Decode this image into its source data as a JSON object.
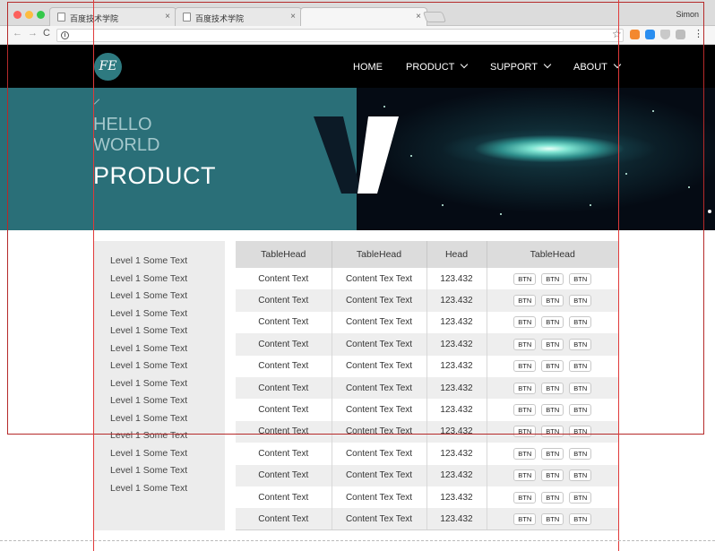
{
  "browser": {
    "tabs": [
      {
        "title": "百度技术学院",
        "close": "×"
      },
      {
        "title": "百度技术学院",
        "close": "×"
      },
      {
        "title": "",
        "close": "×"
      }
    ],
    "profile": "Simon",
    "nav": {
      "back": "←",
      "forward": "→",
      "reload": "C"
    },
    "url": ""
  },
  "header": {
    "logo": "FE",
    "nav": [
      {
        "label": "HOME",
        "dropdown": false
      },
      {
        "label": "PRODUCT",
        "dropdown": true
      },
      {
        "label": "SUPPORT",
        "dropdown": true
      },
      {
        "label": "ABOUT",
        "dropdown": true
      }
    ]
  },
  "hero": {
    "hello": "HELLO",
    "world": "WORLD",
    "title": "PRODUCT",
    "colors": {
      "teal": "#2a6f78"
    }
  },
  "sidebar": {
    "items": [
      "Level 1 Some Text",
      "Level 1 Some Text",
      "Level 1 Some Text",
      "Level 1 Some Text",
      "Level 1 Some Text",
      "Level 1 Some Text",
      "Level 1 Some Text",
      "Level 1 Some Text",
      "Level 1 Some Text",
      "Level 1 Some Text",
      "Level 1 Some Text",
      "Level 1 Some Text",
      "Level 1 Some Text",
      "Level 1 Some Text"
    ]
  },
  "table": {
    "headers": [
      "TableHead",
      "TableHead",
      "Head",
      "TableHead"
    ],
    "rows": [
      [
        "Content Text",
        "Content Tex Text",
        "123.432"
      ],
      [
        "Content Text",
        "Content Tex Text",
        "123.432"
      ],
      [
        "Content Text",
        "Content Tex Text",
        "123.432"
      ],
      [
        "Content Text",
        "Content Tex Text",
        "123.432"
      ],
      [
        "Content Text",
        "Content Tex Text",
        "123.432"
      ],
      [
        "Content Text",
        "Content Tex Text",
        "123.432"
      ],
      [
        "Content Text",
        "Content Tex Text",
        "123.432"
      ],
      [
        "Content Text",
        "Content Tex Text",
        "123.432"
      ],
      [
        "Content Text",
        "Content Tex Text",
        "123.432"
      ],
      [
        "Content Text",
        "Content Tex Text",
        "123.432"
      ],
      [
        "Content Text",
        "Content Tex Text",
        "123.432"
      ],
      [
        "Content Text",
        "Content Tex Text",
        "123.432"
      ]
    ],
    "button_label": "BTN"
  }
}
